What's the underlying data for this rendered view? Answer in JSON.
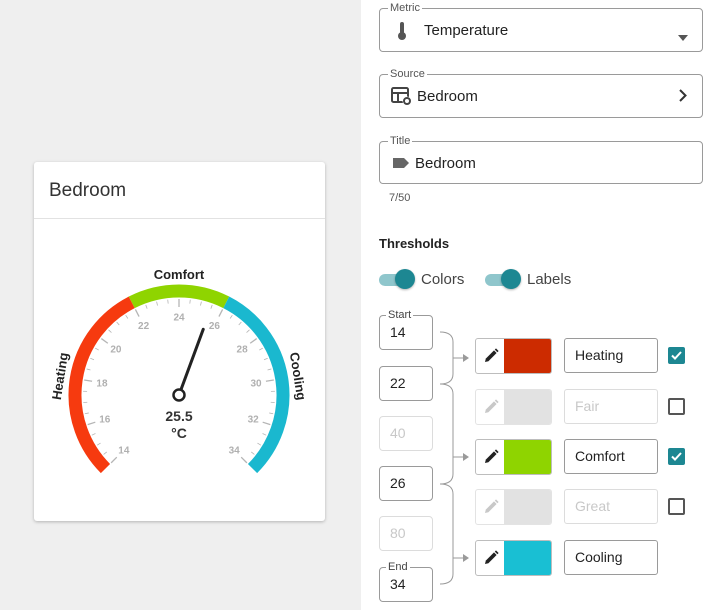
{
  "card": {
    "title": "Bedroom"
  },
  "gauge": {
    "value": 25.5,
    "value_text": "25.5",
    "unit": "°C",
    "min": 14,
    "max": 34,
    "tick_labels": [
      "14",
      "16",
      "18",
      "20",
      "22",
      "24",
      "26",
      "28",
      "30",
      "32",
      "34"
    ],
    "segments": [
      {
        "label": "Heating",
        "from": 14,
        "to": 22,
        "color": "#f63a0f"
      },
      {
        "label": "Comfort",
        "from": 22,
        "to": 26,
        "color": "#8fd400"
      },
      {
        "label": "Cooling",
        "from": 26,
        "to": 34,
        "color": "#1ab8cf"
      }
    ]
  },
  "fields": {
    "metric": {
      "label": "Metric",
      "value": "Temperature",
      "icon": "thermometer-icon"
    },
    "source": {
      "label": "Source",
      "value": "Bedroom",
      "icon": "table-settings-icon"
    },
    "title": {
      "label": "Title",
      "value": "Bedroom",
      "icon": "label-tag-icon",
      "counter": "7/50"
    }
  },
  "thresholds": {
    "heading": "Thresholds",
    "toggles": {
      "colors": "Colors",
      "labels": "Labels"
    },
    "start_label": "Start",
    "end_label": "End",
    "boundaries": [
      {
        "value": "14",
        "enabled": true
      },
      {
        "value": "22",
        "enabled": true
      },
      {
        "value": "40",
        "enabled": false
      },
      {
        "value": "26",
        "enabled": true
      },
      {
        "value": "80",
        "enabled": false
      },
      {
        "value": "34",
        "enabled": true
      }
    ],
    "bands": [
      {
        "label": "Heating",
        "color": "#cc2b00",
        "enabled": true,
        "checked": true,
        "has_checkbox": true
      },
      {
        "label": "Fair",
        "color": "#e2e2e2",
        "enabled": false,
        "checked": false,
        "has_checkbox": true
      },
      {
        "label": "Comfort",
        "color": "#8fd400",
        "enabled": true,
        "checked": true,
        "has_checkbox": true
      },
      {
        "label": "Great",
        "color": "#e2e2e2",
        "enabled": false,
        "checked": false,
        "has_checkbox": true
      },
      {
        "label": "Cooling",
        "color": "#19bfd3",
        "enabled": true,
        "checked": false,
        "has_checkbox": false
      }
    ]
  },
  "colors": {
    "accent": "#1d8792",
    "toggle_track": "#8fc6cc"
  }
}
